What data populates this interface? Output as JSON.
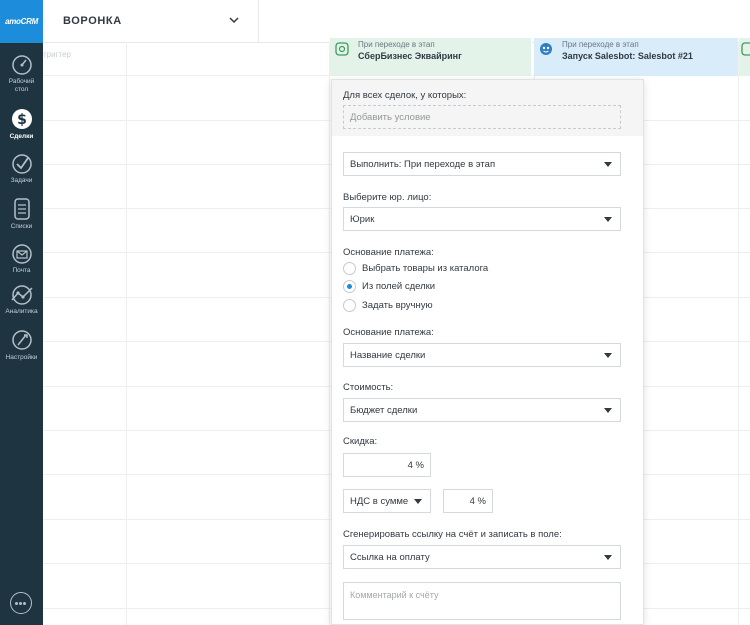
{
  "sidebar": {
    "logo": "amoCRM",
    "items": [
      {
        "label_line1": "Рабочий",
        "label_line2": "стол",
        "icon": "dashboard-icon"
      },
      {
        "label": "Сделки",
        "icon": "deals-icon"
      },
      {
        "label": "Задачи",
        "icon": "tasks-icon"
      },
      {
        "label": "Списки",
        "icon": "lists-icon"
      },
      {
        "label": "Почта",
        "icon": "mail-icon"
      },
      {
        "label": "Аналитика",
        "icon": "analytics-icon"
      },
      {
        "label": "Настройки",
        "icon": "settings-icon"
      }
    ],
    "active_item": "Сделки",
    "chat_icon": "chat-icon"
  },
  "header": {
    "pipeline_title": "ВОРОНКА"
  },
  "grid": {
    "trigger_label": "тригтер"
  },
  "stages": [
    {
      "line1": "При переходе в этап",
      "line2": "СберБизнес Эквайринг",
      "icon": "plugin-icon"
    },
    {
      "line1": "При переходе в этап",
      "line2": "Запуск Salesbot: Salesbot #21",
      "icon": "bot-icon"
    }
  ],
  "panel": {
    "condition_label": "Для всех сделок, у которых:",
    "add_condition": "Добавить условие",
    "execute_select": "Выполнить: При переходе в этап",
    "legal_entity_label": "Выберите юр. лицо:",
    "legal_entity_value": "Юрик",
    "payment_basis_label": "Основание платежа:",
    "radio_options": [
      "Выбрать товары из каталога",
      "Из полей сделки",
      "Задать вручную"
    ],
    "radio_selected": "Из полей сделки",
    "payment_basis_label2": "Основание платежа:",
    "payment_basis_value": "Название сделки",
    "cost_label": "Стоимость:",
    "cost_value": "Бюджет сделки",
    "discount_label": "Скидка:",
    "discount_value": "4 %",
    "vat_mode": "НДС в сумме",
    "vat_value": "4 %",
    "link_label": "Сгенерировать ссылку на счёт и записать в поле:",
    "link_value": "Ссылка на оплату",
    "comment_placeholder": "Комментарий к счёту"
  },
  "colors": {
    "sidebar_bg": "#1e3441",
    "logo_bg": "#1d8ddb",
    "stage_green": "#e4f3ea",
    "stage_blue": "#d8ecf9",
    "accent": "#1d8ddb"
  }
}
